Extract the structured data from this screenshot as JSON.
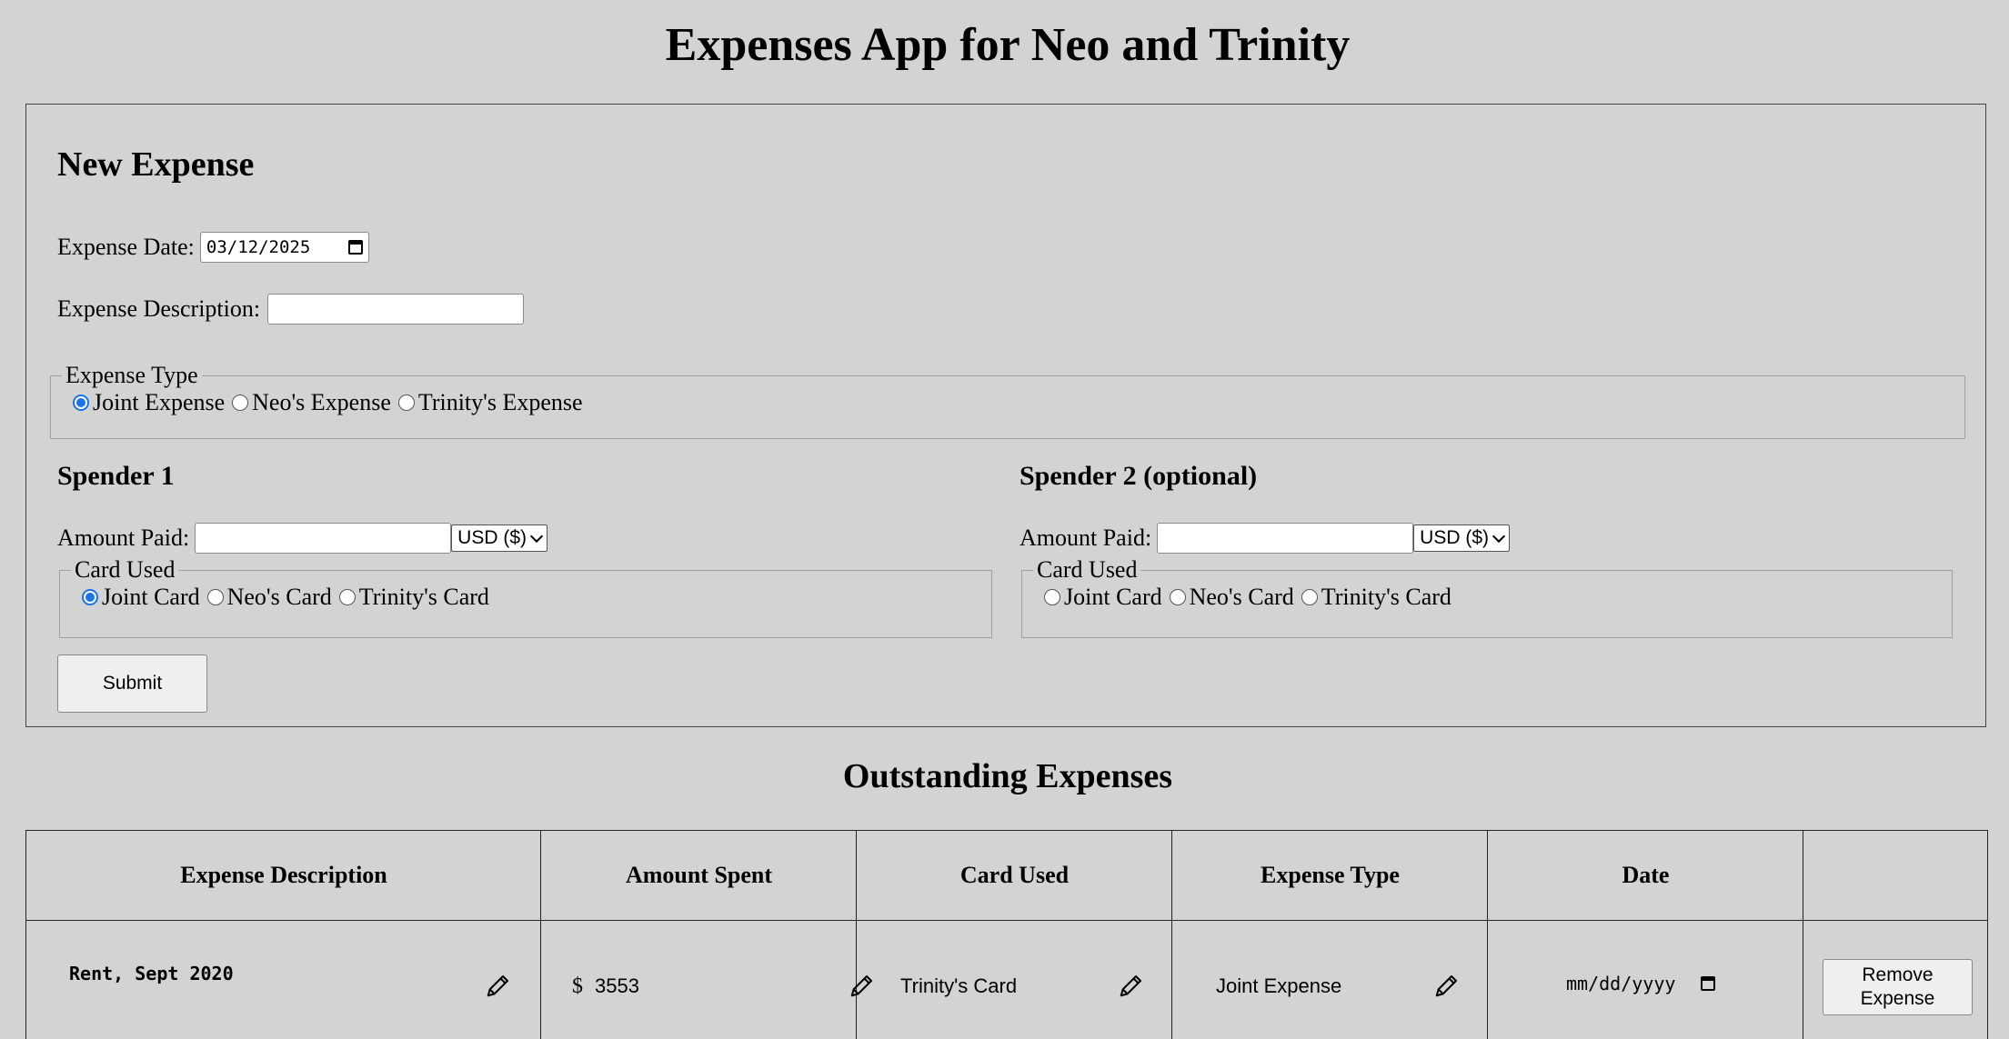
{
  "app": {
    "title": "Expenses App for Neo and Trinity"
  },
  "new_expense": {
    "title": "New Expense",
    "date_label": "Expense Date:",
    "date_value": "03/12/2025",
    "description_label": "Expense Description:",
    "description_value": "",
    "expense_type": {
      "legend": "Expense Type",
      "options": [
        "Joint Expense",
        "Neo's Expense",
        "Trinity's Expense"
      ],
      "selected": "Joint Expense"
    },
    "spender1": {
      "title": "Spender 1",
      "amount_label": "Amount Paid:",
      "amount_value": "",
      "currency": "USD ($)",
      "card_legend": "Card Used",
      "card_options": [
        "Joint Card",
        "Neo's Card",
        "Trinity's Card"
      ],
      "card_selected": "Joint Card"
    },
    "spender2": {
      "title": "Spender 2 (optional)",
      "amount_label": "Amount Paid:",
      "amount_value": "",
      "currency": "USD ($)",
      "card_legend": "Card Used",
      "card_options": [
        "Joint Card",
        "Neo's Card",
        "Trinity's Card"
      ],
      "card_selected": ""
    },
    "submit_label": "Submit"
  },
  "outstanding": {
    "title": "Outstanding Expenses",
    "columns": [
      "Expense Description",
      "Amount Spent",
      "Card Used",
      "Expense Type",
      "Date",
      ""
    ],
    "rows": [
      {
        "description": "Rent, Sept 2020",
        "currency_symbol": "$",
        "amount": "3553",
        "card": "Trinity's Card",
        "type": "Joint Expense",
        "date_placeholder": "mm/dd/yyyy",
        "remove_label": "Remove\nExpense"
      }
    ]
  },
  "icons": {
    "edit": "pencil-icon",
    "calendar": "calendar-icon",
    "dropdown": "chevron-down-icon"
  },
  "colors": {
    "background": "#d3d3d3",
    "radio_accent": "#1a73e8"
  }
}
